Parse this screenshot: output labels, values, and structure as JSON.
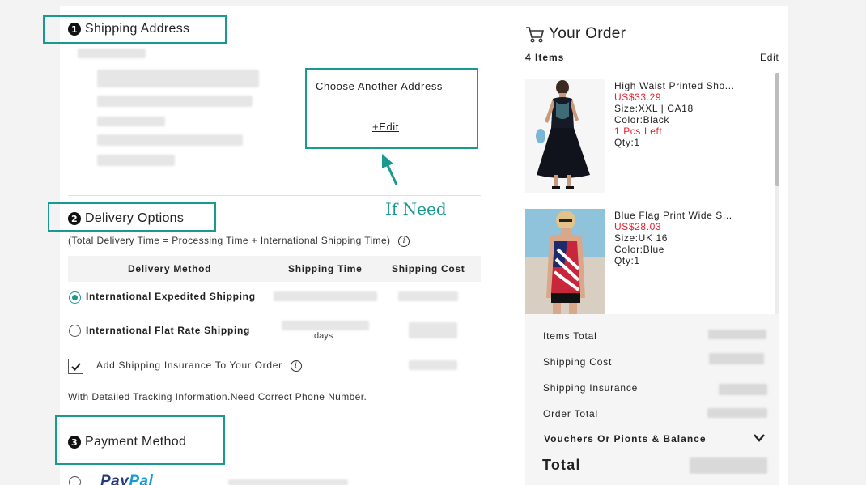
{
  "shipping": {
    "title": "Shipping Address",
    "step": "1",
    "choose_link": "Choose Another Address",
    "edit_link": "+Edit"
  },
  "hint": "If Need",
  "delivery": {
    "title": "Delivery Options",
    "step": "2",
    "note": "(Total Delivery Time = Processing Time + International Shipping Time)",
    "info_icon": "info-icon",
    "columns": [
      "Delivery Method",
      "Shipping Time",
      "Shipping Cost"
    ],
    "options": [
      {
        "label": "International Expedited Shipping",
        "selected": true
      },
      {
        "label": "International Flat Rate Shipping",
        "selected": false,
        "time_suffix": "days"
      }
    ],
    "insurance_label": "Add Shipping Insurance To Your Order",
    "insurance_checked": true,
    "tracking_note": "With Detailed Tracking Information.Need Correct Phone Number."
  },
  "payment": {
    "title": "Payment Method",
    "step": "3",
    "paypal_left": "PayPal",
    "paypal_right": "Pal"
  },
  "order": {
    "title": "Your Order",
    "cart_icon": "cart-icon",
    "count": "4 Items",
    "edit": "Edit",
    "items": [
      {
        "name": "High Waist Printed Sho...",
        "price": "US$33.29",
        "size": "Size:XXL | CA18",
        "color": "Color:Black",
        "stock": "1 Pcs Left",
        "qty": "Qty:1"
      },
      {
        "name": "Blue Flag Print Wide S...",
        "price": "US$28.03",
        "size": "Size:UK 16",
        "color": "Color:Blue",
        "qty": "Qty:1"
      }
    ],
    "summary": {
      "items_total": "Items Total",
      "shipping_cost": "Shipping Cost",
      "shipping_insurance": "Shipping Insurance",
      "order_total": "Order Total",
      "vouchers": "Vouchers Or Pionts & Balance",
      "total": "Total"
    }
  },
  "colors": {
    "accent": "#1a9991",
    "price_red": "#e8212e"
  }
}
